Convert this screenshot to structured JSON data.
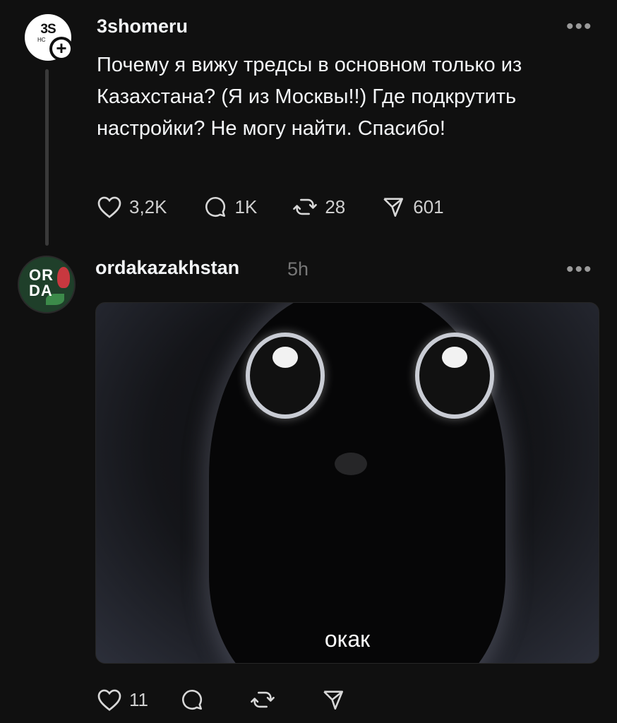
{
  "post1": {
    "avatar_text": "3S",
    "avatar_subtext": "HC",
    "follow_icon": "plus-icon",
    "username": "3shomeru",
    "text": "Почему я вижу тредсы в основном только из Казахстана? (Я из Москвы!!) Где подкрутить настройки? Не могу найти. Спасибо!",
    "likes": "3,2K",
    "replies": "1K",
    "reposts": "28",
    "shares": "601"
  },
  "post2": {
    "avatar_text": "OR DA",
    "username": "ordakazakhstan",
    "time": "5h",
    "image_caption": "окак",
    "likes": "11"
  }
}
